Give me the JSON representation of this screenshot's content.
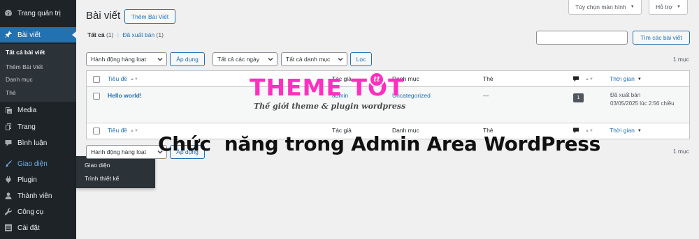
{
  "sidebar": {
    "items": [
      {
        "icon": "dashboard-icon",
        "label": "Trang quản trị"
      },
      {
        "icon": "pin-icon",
        "label": "Bài viết"
      },
      {
        "icon": "media-icon",
        "label": "Media"
      },
      {
        "icon": "page-icon",
        "label": "Trang"
      },
      {
        "icon": "comment-icon",
        "label": "Bình luận"
      },
      {
        "icon": "brush-icon",
        "label": "Giao diện"
      },
      {
        "icon": "plugin-icon",
        "label": "Plugin"
      },
      {
        "icon": "user-icon",
        "label": "Thành viên"
      },
      {
        "icon": "wrench-icon",
        "label": "Công cụ"
      },
      {
        "icon": "settings-icon",
        "label": "Cài đặt"
      }
    ],
    "posts_submenu": [
      "Tất cả bài viết",
      "Thêm Bài Viết",
      "Danh mục",
      "Thẻ"
    ],
    "appearance_flyout": [
      "Giao diện",
      "Trình thiết kế"
    ]
  },
  "header": {
    "title": "Bài viết",
    "add_new": "Thêm Bài Viết",
    "screen_options": "Tùy chọn màn hình",
    "help": "Hỗ trợ"
  },
  "views": {
    "all_label": "Tất cả",
    "all_count": "(1)",
    "separator": "|",
    "published_label": "Đã xuất bản",
    "published_count": "(1)"
  },
  "search": {
    "button": "Tìm các bài viết",
    "value": ""
  },
  "filters": {
    "bulk_action": "Hành động hàng loạt",
    "apply": "Áp dụng",
    "dates": "Tất cả các ngày",
    "categories": "Tất cả danh mục",
    "filter": "Lọc",
    "count": "1 mục"
  },
  "table": {
    "columns": {
      "title": "Tiêu đề",
      "author": "Tác giả",
      "categories": "Danh mục",
      "tags": "Thẻ",
      "date": "Thời gian"
    },
    "rows": [
      {
        "title": "Hello world!",
        "author": "admin",
        "category": "Uncategorized",
        "tags": "—",
        "comments": "1",
        "date_status": "Đã xuất bản",
        "date": "03/05/2025 lúc 2:56 chiều"
      }
    ]
  },
  "overlay": {
    "logo": "THEME TOT",
    "logo_badge": "tt",
    "tagline": "Thế giới theme & plugin wordpress",
    "banner": "Chức  năng trong Admin Area WordPress"
  },
  "colors": {
    "accent": "#2271b1",
    "sidebar": "#1d2327",
    "logo": "#ff2fc0"
  }
}
